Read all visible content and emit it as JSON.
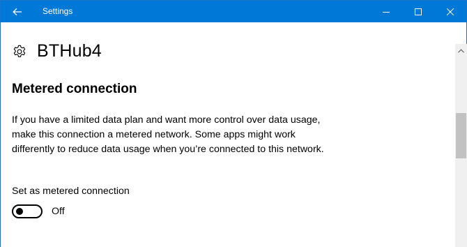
{
  "window": {
    "title": "Settings",
    "accent": "#0078d7"
  },
  "icons": {
    "back": "back-arrow-icon",
    "minimize": "minimize-icon",
    "maximize": "maximize-icon",
    "close": "close-icon",
    "page": "gear-icon"
  },
  "page": {
    "title": "BTHub4"
  },
  "section": {
    "title": "Metered connection",
    "description": "If you have a limited data plan and want more control over data usage, make this connection a metered network. Some apps might work differently to reduce data usage when you’re connected to this network."
  },
  "metered_toggle": {
    "label": "Set as metered connection",
    "state_label": "Off",
    "on": false
  }
}
